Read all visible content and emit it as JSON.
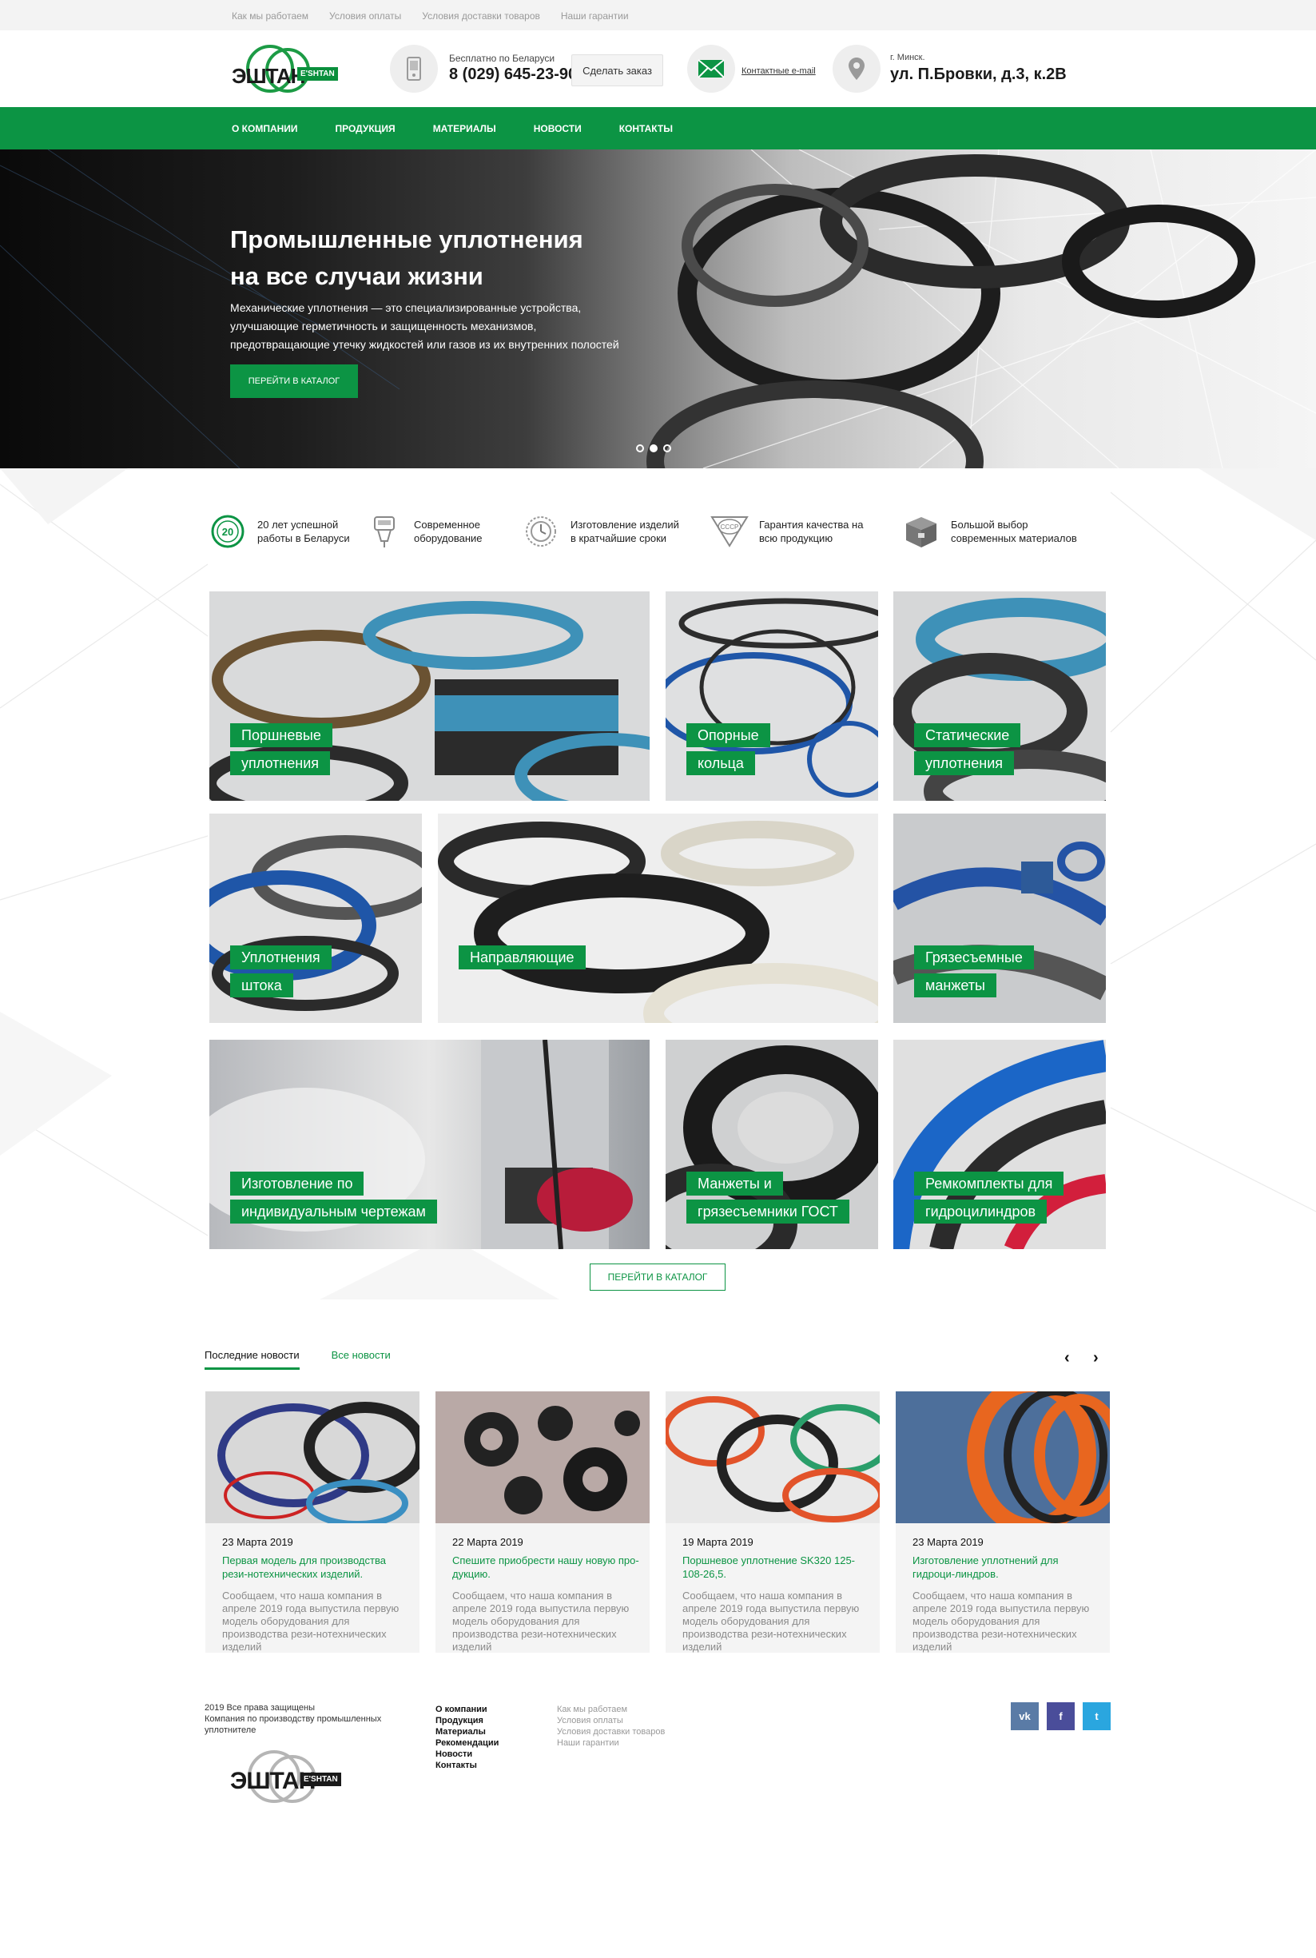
{
  "topbar": {
    "links": [
      "Как мы работаем",
      "Условия оплаты",
      "Условия доставки товаров",
      "Наши гарантии"
    ]
  },
  "header": {
    "logo_word": "ЭШТАН",
    "logo_tag": "E'SHTAN",
    "phone_note": "Бесплатно по Беларуси",
    "phone": "8 (029) 645-23-90",
    "order_button": "Сделать заказ",
    "email_link": "Контактные e-mail",
    "city": "г. Минск.",
    "address": "ул. П.Бровки, д.3, к.2В",
    "icons": {
      "phone": "phone-icon",
      "mail": "mail-icon",
      "location": "location-pin-icon"
    }
  },
  "nav": {
    "items": [
      "О КОМПАНИИ",
      "ПРОДУКЦИЯ",
      "МАТЕРИАЛЫ",
      "НОВОСТИ",
      "КОНТАКТЫ"
    ]
  },
  "hero": {
    "title_line1": "Промышленные уплотнения",
    "title_line2": "на все случаи жизни",
    "description": "Механические уплотнения — это специализированные устройства, улучшающие герметичность и защищенность механизмов, предотвращающие утечку жидкостей или газов из их внутренних полостей",
    "button": "ПЕРЕЙТИ В КАТАЛОГ",
    "slides_total": 3,
    "slide_active": 2
  },
  "features": [
    {
      "icon": "20-years-badge-icon",
      "badge": "20",
      "line1": "20 лет успешной",
      "line2": "работы в Беларуси"
    },
    {
      "icon": "equipment-icon",
      "line1": "Современное",
      "line2": "оборудование"
    },
    {
      "icon": "stopwatch-icon",
      "line1": "Изготовление изделий",
      "line2": "в кратчайшие сроки"
    },
    {
      "icon": "quality-mark-icon",
      "badge": "СССР",
      "line1": "Гарантия качества на",
      "line2": "всю продукцию"
    },
    {
      "icon": "box-icon",
      "line1": "Большой выбор",
      "line2": "современных материалов"
    }
  ],
  "catalog": {
    "tiles": [
      {
        "line1": "Поршневые",
        "line2": "уплотнения"
      },
      {
        "line1": "Опорные",
        "line2": "кольца"
      },
      {
        "line1": "Статические",
        "line2": "уплотнения"
      },
      {
        "line1": "Уплотнения",
        "line2": "штока"
      },
      {
        "line1": "Направляющие",
        "line2": ""
      },
      {
        "line1": "Грязесъемные",
        "line2": "манжеты"
      },
      {
        "line1": "Изготовление по",
        "line2": "индивидуальным чертежам"
      },
      {
        "line1": "Манжеты и",
        "line2": "грязесъемники ГОСТ"
      },
      {
        "line1": "Ремкомплекты для",
        "line2": "гидроцилиндров"
      }
    ],
    "button": "ПЕРЕЙТИ В КАТАЛОГ"
  },
  "news": {
    "tab_latest": "Последние новости",
    "tab_all": "Все новости",
    "prev": "‹",
    "next": "›",
    "items": [
      {
        "date": "23 Марта 2019",
        "title": "Первая модель для производства рези-нотехнических изделий.",
        "text": "Сообщаем, что наша компания в апреле 2019 года выпустила первую модель оборудования для производства рези-нотехнических изделий"
      },
      {
        "date": "22 Марта 2019",
        "title": "Спешите приобрести нашу новую про-дукцию.",
        "text": "Сообщаем, что наша компания в апреле 2019 года выпустила первую модель оборудования для производства рези-нотехнических изделий"
      },
      {
        "date": "19 Марта 2019",
        "title": "Поршневое уплотнение SK320 125-108-26,5.",
        "text": "Сообщаем, что наша компания в апреле 2019 года выпустила первую модель оборудования для производства рези-нотехнических изделий"
      },
      {
        "date": "23 Марта 2019",
        "title": "Изготовление уплотнений для гидроци-линдров.",
        "text": "Сообщаем, что наша компания в апреле 2019 года выпустила первую модель оборудования для производства рези-нотехнических изделий"
      }
    ]
  },
  "footer": {
    "copyright": "2019 Все права защищены",
    "company": "Компания по производству промышленных уплотнителе",
    "logo_word": "ЭШТАН",
    "logo_tag": "E'SHTAN",
    "menu_main": [
      "О компании",
      "Продукция",
      "Материалы",
      "Рекомендации",
      "Новости",
      "Контакты"
    ],
    "menu_secondary": [
      "Как мы работаем",
      "Условия оплаты",
      "Условия доставки товаров",
      "Наши гарантии"
    ],
    "social": [
      {
        "icon": "vk-icon",
        "label": "vk",
        "color": "#5a7ba6"
      },
      {
        "icon": "facebook-icon",
        "label": "f",
        "color": "#4a4d9a"
      },
      {
        "icon": "twitter-icon",
        "label": "t",
        "color": "#2aa6df"
      }
    ]
  },
  "colors": {
    "brand_green": "#0c9444",
    "text_dark": "#222222",
    "muted": "#8a8a8a"
  }
}
